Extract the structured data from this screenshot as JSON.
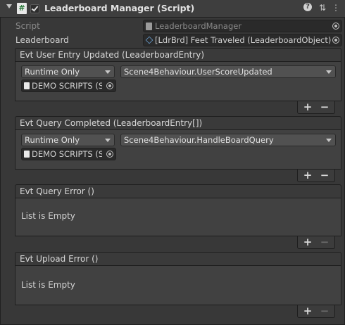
{
  "header": {
    "title": "Leaderboard Manager (Script)",
    "script_glyph": "#",
    "icons": [
      "help-icon",
      "preset-icon",
      "menu-icon"
    ]
  },
  "fields": {
    "script": {
      "label": "Script",
      "value": "LeaderboardManager"
    },
    "leaderboard": {
      "label": "Leaderboard",
      "value": "[LdrBrd] Feet Traveled (LeaderboardObject)"
    }
  },
  "events": [
    {
      "title": "Evt User Entry Updated (LeaderboardEntry)",
      "mode": "Runtime Only",
      "function": "Scene4Behaviour.UserScoreUpdated",
      "target": "DEMO SCRIPTS (S",
      "add": "+",
      "remove": "−"
    },
    {
      "title": "Evt Query Completed (LeaderboardEntry[])",
      "mode": "Runtime Only",
      "function": "Scene4Behaviour.HandleBoardQuery",
      "target": "DEMO SCRIPTS (S",
      "add": "+",
      "remove": "−"
    },
    {
      "title": "Evt Query Error ()",
      "empty_text": "List is Empty",
      "add": "+",
      "remove": "−"
    },
    {
      "title": "Evt Upload Error ()",
      "empty_text": "List is Empty",
      "add": "+",
      "remove": "−"
    }
  ],
  "colors": {
    "background": "#383838",
    "panel": "#414141",
    "field": "#2a2a2a"
  }
}
